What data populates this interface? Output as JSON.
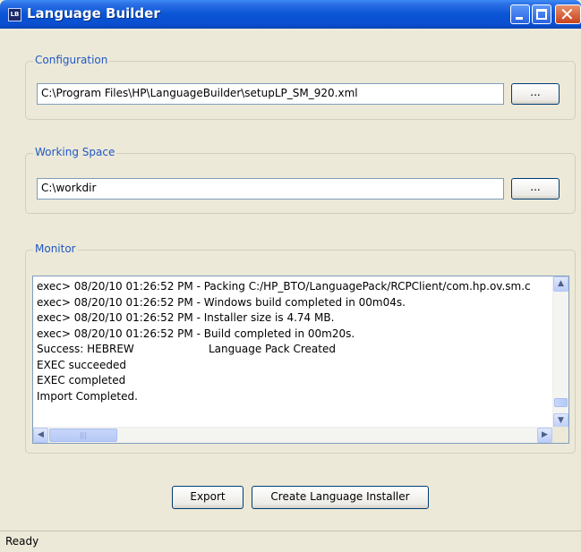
{
  "window": {
    "title": "Language Builder",
    "icon_text": "LB"
  },
  "configuration": {
    "legend": "Configuration",
    "path_value": "C:\\Program Files\\HP\\LanguageBuilder\\setupLP_SM_920.xml",
    "browse_label": "..."
  },
  "working_space": {
    "legend": "Working Space",
    "path_value": "C:\\workdir",
    "browse_label": "..."
  },
  "monitor": {
    "legend": "Monitor",
    "lines": [
      "exec> 08/20/10 01:26:52 PM - Packing C:/HP_BTO/LanguagePack/RCPClient/com.hp.ov.sm.c",
      "exec> 08/20/10 01:26:52 PM - Windows build completed in 00m04s.",
      "exec> 08/20/10 01:26:52 PM - Installer size is 4.74 MB.",
      "exec> 08/20/10 01:26:52 PM - Build completed in 00m20s.",
      " Success: HEBREW",
      "EXEC  succeeded",
      "EXEC  completed",
      "Import  Completed."
    ],
    "success_message": "Language Pack Created"
  },
  "actions": {
    "export_label": "Export",
    "create_label": "Create Language Installer"
  },
  "status": {
    "text": "Ready"
  }
}
